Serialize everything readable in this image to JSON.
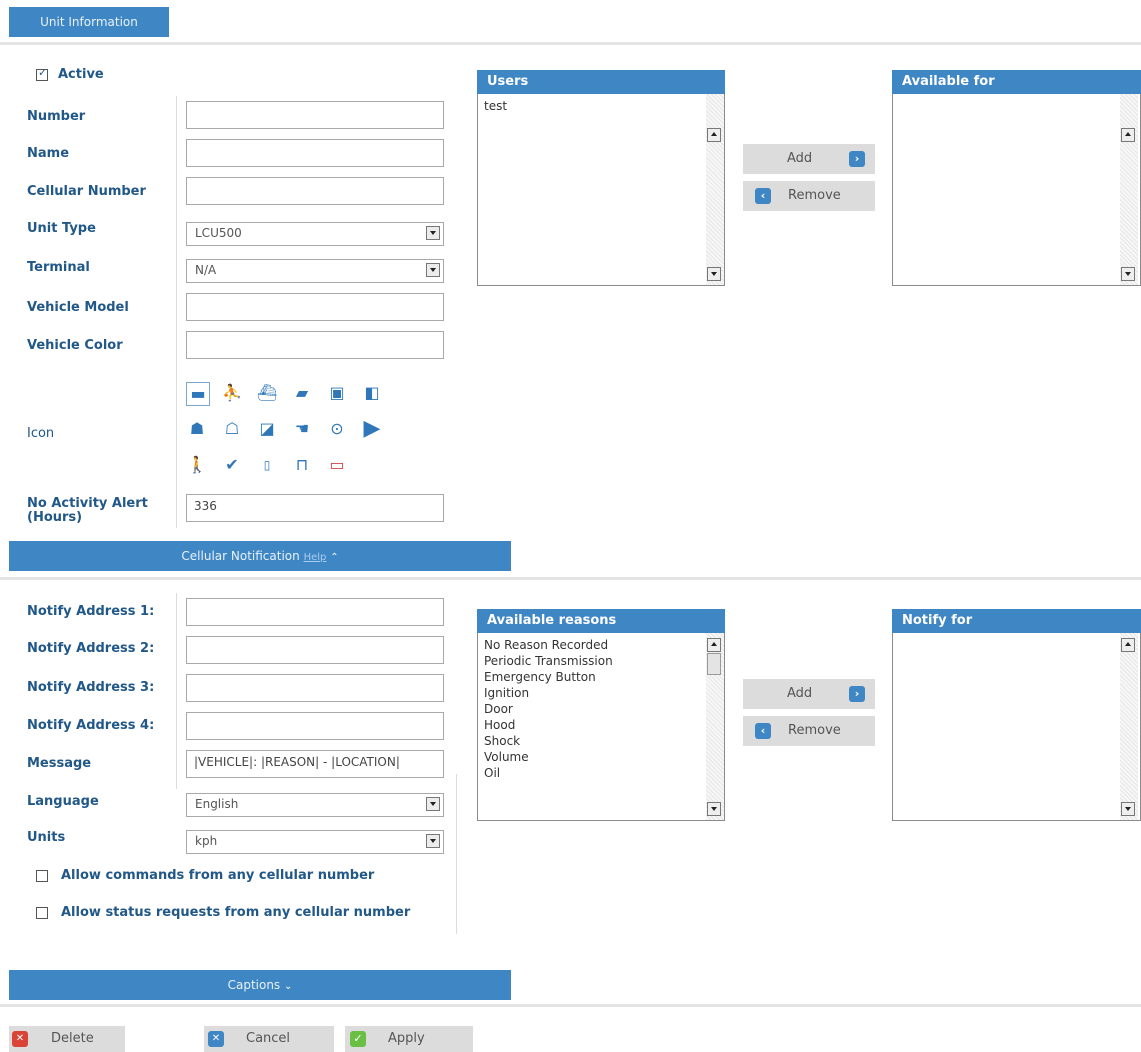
{
  "tabs": {
    "unit_information": "Unit Information"
  },
  "unit": {
    "active_label": "Active",
    "active_checked": true,
    "fields": [
      {
        "label": "Number",
        "value": ""
      },
      {
        "label": "Name",
        "value": ""
      },
      {
        "label": "Cellular Number",
        "value": ""
      },
      {
        "label": "Vehicle Model",
        "value": ""
      },
      {
        "label": "Vehicle Color",
        "value": ""
      }
    ],
    "unit_type": {
      "label": "Unit Type",
      "value": "LCU500"
    },
    "terminal": {
      "label": "Terminal",
      "value": "N/A"
    },
    "icon_label": "Icon",
    "icons": [
      "car-icon",
      "crowd-icon",
      "boat-icon",
      "sedan-icon",
      "truck-icon",
      "tow-truck-icon",
      "motorcycle-icon",
      "quad-icon",
      "heavy-truck-icon",
      "hand-icon",
      "target-icon",
      "play-arrow-icon",
      "walker-icon",
      "pointer-icon",
      "phone-icon",
      "lock-icon",
      "flag-icon"
    ],
    "no_activity_label_1": "No Activity Alert",
    "no_activity_label_2": "(Hours)",
    "no_activity_value": "336"
  },
  "users_panel": {
    "users_title": "Users",
    "users": [
      "test"
    ],
    "available_title": "Available for",
    "available": [],
    "add_label": "Add",
    "remove_label": "Remove"
  },
  "cellular_notification": {
    "section_title": "Cellular Notification",
    "help_link": "Help",
    "fields": [
      {
        "label": "Notify Address 1:",
        "value": ""
      },
      {
        "label": "Notify Address 2:",
        "value": ""
      },
      {
        "label": "Notify Address 3:",
        "value": ""
      },
      {
        "label": "Notify Address 4:",
        "value": ""
      }
    ],
    "message": {
      "label": "Message",
      "value": "|VEHICLE|: |REASON| - |LOCATION|"
    },
    "language": {
      "label": "Language",
      "value": "English"
    },
    "units": {
      "label": "Units",
      "value": "kph"
    },
    "allow_commands": "Allow commands from any cellular number",
    "allow_status": "Allow status requests from any cellular number"
  },
  "reasons_panel": {
    "available_title": "Available reasons",
    "reasons": [
      "No Reason Recorded",
      "Periodic Transmission",
      "Emergency Button",
      "Ignition",
      "Door",
      "Hood",
      "Shock",
      "Volume",
      "Oil"
    ],
    "notify_title": "Notify for",
    "notify": [],
    "add_label": "Add",
    "remove_label": "Remove"
  },
  "captions": {
    "section_title": "Captions"
  },
  "footer": {
    "delete_label": "Delete",
    "cancel_label": "Cancel",
    "apply_label": "Apply"
  },
  "colors": {
    "accent": "#3f86c4",
    "label": "#215888",
    "delete": "#d94437",
    "apply": "#6bbf44"
  }
}
